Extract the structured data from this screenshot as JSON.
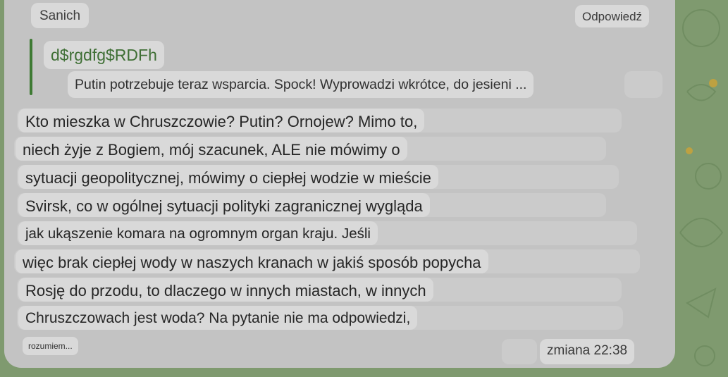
{
  "message": {
    "sender": "Sanich",
    "reply_label": "Odpowiedź",
    "quote": {
      "author": "d$rgdfg$RDFh",
      "text": "Putin potrzebuje teraz wsparcia. Spock! Wyprowadzi wkrótce, do jesieni ..."
    },
    "lines": [
      "Kto mieszka w Chruszczowie? Putin? Ornojew? Mimo to,",
      "niech żyje z Bogiem, mój szacunek, ALE nie mówimy o",
      "sytuacji geopolitycznej, mówimy o ciepłej wodzie w mieście",
      "Svirsk, co w ogólnej sytuacji polityki zagranicznej wygląda",
      "jak ukąszenie komara na ogromnym organ kraju. Jeśli",
      "więc brak ciepłej wody w naszych kranach w jakiś sposób popycha",
      "Rosję do przodu, to dlaczego w innych miastach, w innych",
      "Chruszczowach jest woda? Na pytanie nie ma odpowiedzi,"
    ],
    "ellipsis": "rozumiem...",
    "meta": "zmiana 22:38"
  },
  "colors": {
    "wallpaper": "#7f9a6f",
    "bubble": "#c3c3c3",
    "chip": "#d9d9d9",
    "quote_accent": "#3e7a33"
  }
}
